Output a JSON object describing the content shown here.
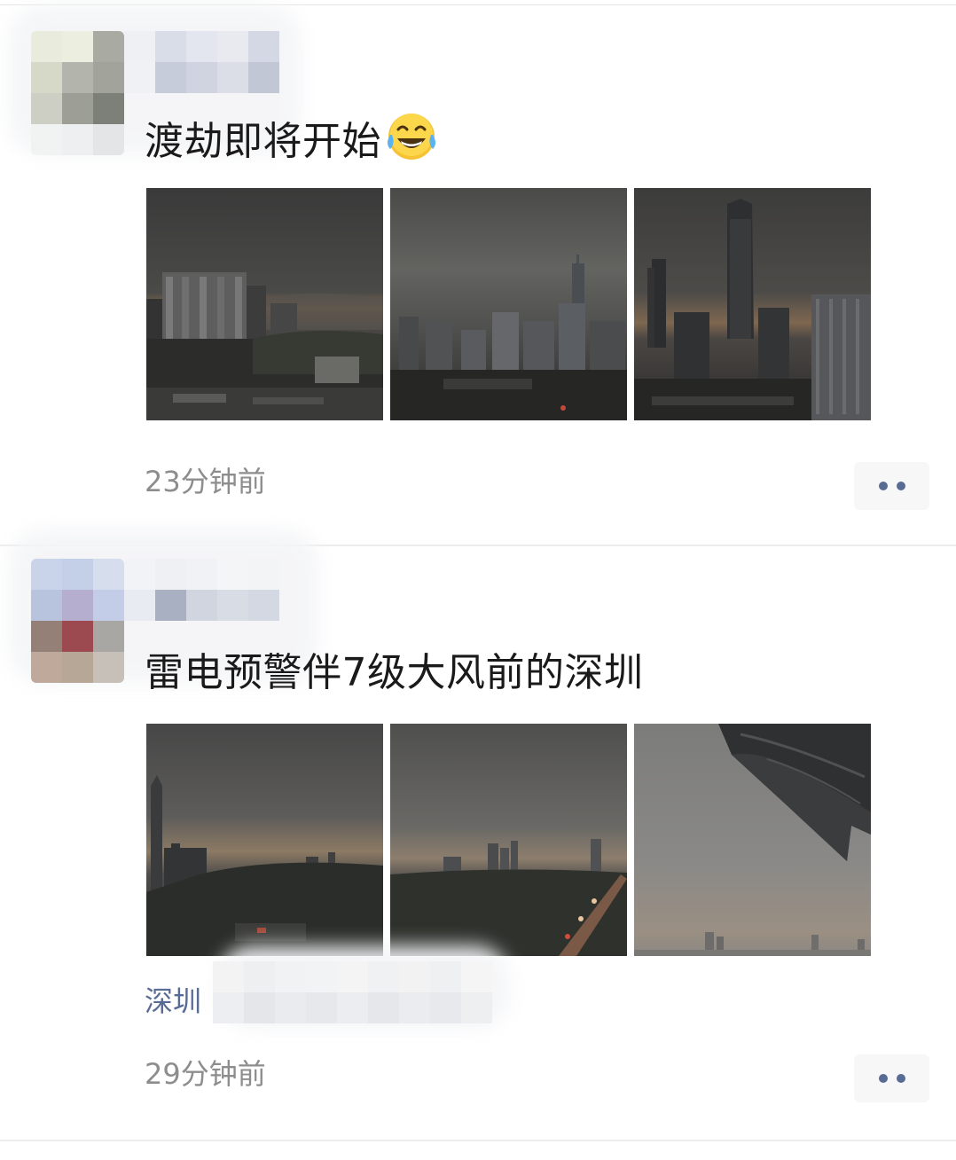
{
  "posts": [
    {
      "text": "渡劫即将开始",
      "emoji": "tears-of-joy-emoji",
      "timestamp": "23分钟前",
      "photo_count": 3
    },
    {
      "text": "雷电预警伴7级大风前的深圳",
      "location": "深圳",
      "timestamp": "29分钟前",
      "photo_count": 3
    }
  ],
  "icons": {
    "more": "more-dots-icon",
    "avatar": "pixelated-avatar"
  },
  "colors": {
    "link_blue": "#576b95",
    "text_primary": "#1a1a1a",
    "text_secondary": "#8d8d8d",
    "more_button_bg": "#f7f7f7"
  }
}
